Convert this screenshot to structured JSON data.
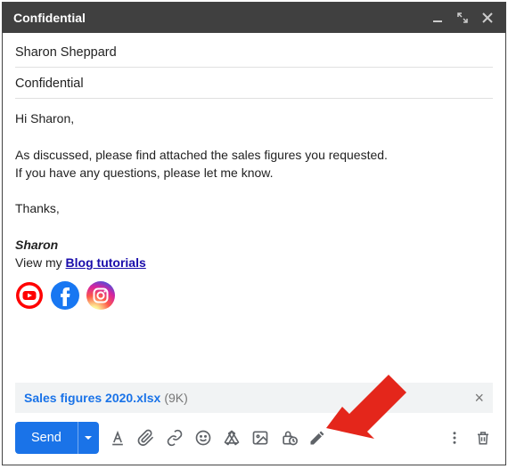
{
  "titlebar": {
    "title": "Confidential"
  },
  "fields": {
    "to": "Sharon Sheppard",
    "subject": "Confidential"
  },
  "body": {
    "greeting": "Hi Sharon,",
    "p1": "As discussed, please find attached the sales figures you requested.",
    "p2": "If you have any questions, please let me know.",
    "closing": "Thanks,",
    "sig_name": "Sharon",
    "sig_prefix": "View my ",
    "sig_link": "Blog tutorials"
  },
  "attachment": {
    "name": "Sales figures 2020.xlsx",
    "size": "(9K)"
  },
  "toolbar": {
    "send_label": "Send"
  },
  "colors": {
    "primary": "#1a73e8",
    "youtube_red": "#ff0000",
    "facebook_blue": "#1877f2"
  }
}
